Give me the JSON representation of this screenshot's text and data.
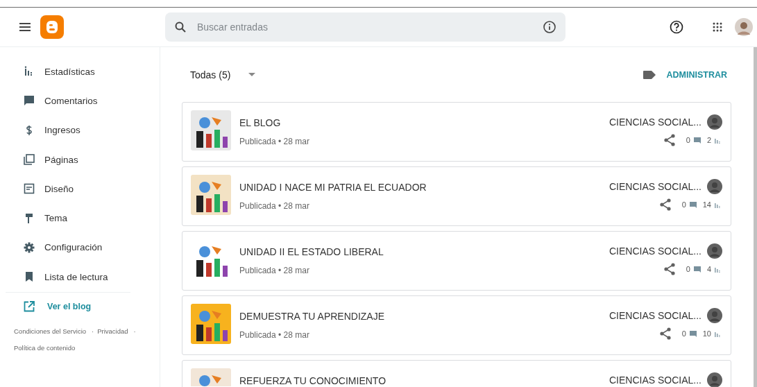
{
  "header": {
    "search": {
      "placeholder": "Buscar entradas"
    }
  },
  "sidebar": {
    "items": [
      {
        "label": "Estadísticas"
      },
      {
        "label": "Comentarios"
      },
      {
        "label": "Ingresos"
      },
      {
        "label": "Páginas"
      },
      {
        "label": "Diseño"
      },
      {
        "label": "Tema"
      },
      {
        "label": "Configuración"
      },
      {
        "label": "Lista de lectura"
      }
    ],
    "view_blog": "Ver el blog",
    "footer_links": [
      "Condiciones del Servicio",
      "Privacidad",
      "Política de contenido"
    ],
    "footer_separator": "·"
  },
  "toolbar": {
    "filter": "Todas (5)",
    "manage": "ADMINISTRAR"
  },
  "posts": [
    {
      "title": "EL BLOG",
      "status": "Publicada • 28 mar",
      "author": "CIENCIAS SOCIAL...",
      "comments": "0",
      "views": "2"
    },
    {
      "title": "UNIDAD I NACE MI PATRIA EL ECUADOR",
      "status": "Publicada • 28 mar",
      "author": "CIENCIAS SOCIAL...",
      "comments": "0",
      "views": "14"
    },
    {
      "title": "UNIDAD II EL ESTADO LIBERAL",
      "status": "Publicada • 28 mar",
      "author": "CIENCIAS SOCIAL...",
      "comments": "0",
      "views": "4"
    },
    {
      "title": "DEMUESTRA TU APRENDIZAJE",
      "status": "Publicada • 28 mar",
      "author": "CIENCIAS SOCIAL...",
      "comments": "0",
      "views": "10"
    },
    {
      "title": "REFUERZA TU CONOCIMIENTO",
      "author": "CIENCIAS SOCIAL..."
    }
  ]
}
